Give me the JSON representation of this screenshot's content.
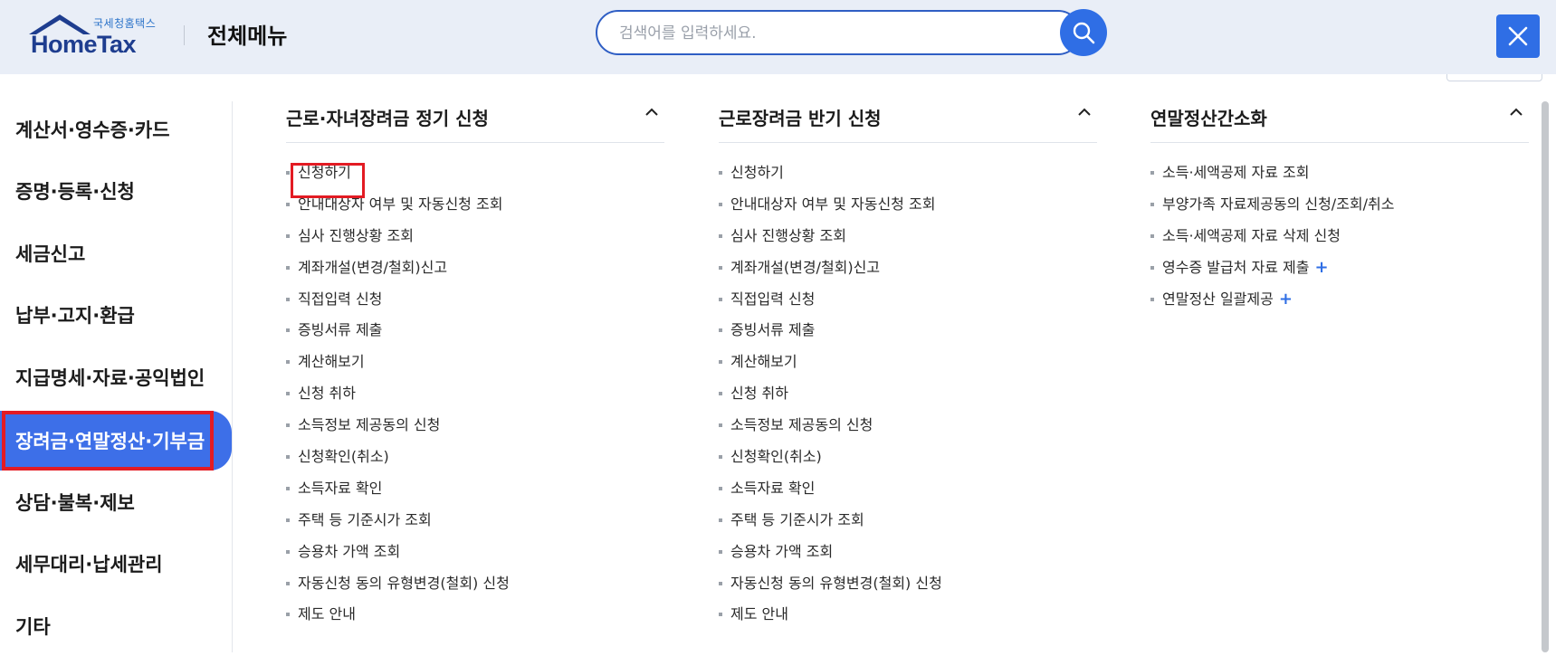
{
  "header": {
    "logo_sub": "국세청홈택스",
    "logo_main": "HomeTax",
    "title": "전체메뉴",
    "search_placeholder": "검색어를 입력하세요."
  },
  "icons": {
    "search": "search-icon",
    "close": "close-icon",
    "chevron": "chevron-up-icon",
    "plus": "plus-icon"
  },
  "colors": {
    "accent": "#2f6ee5",
    "active_bg": "#3d6fe8",
    "highlight": "#e31b23",
    "header_bg": "#e9eef7"
  },
  "sidebar": {
    "items": [
      {
        "label": "계산서·영수증·카드"
      },
      {
        "label": "증명·등록·신청"
      },
      {
        "label": "세금신고"
      },
      {
        "label": "납부·고지·환급"
      },
      {
        "label": "지급명세·자료·공익법인"
      },
      {
        "label": "장려금·연말정산·기부금",
        "active": true
      },
      {
        "label": "상담·불복·제보"
      },
      {
        "label": "세무대리·납세관리"
      },
      {
        "label": "기타"
      }
    ]
  },
  "columns": [
    {
      "title": "근로·자녀장려금 정기 신청",
      "items": [
        {
          "label": "신청하기"
        },
        {
          "label": "안내대상자 여부 및 자동신청 조회"
        },
        {
          "label": "심사 진행상황 조회"
        },
        {
          "label": "계좌개설(변경/철회)신고"
        },
        {
          "label": "직접입력 신청"
        },
        {
          "label": "증빙서류 제출"
        },
        {
          "label": "계산해보기"
        },
        {
          "label": "신청 취하"
        },
        {
          "label": "소득정보 제공동의 신청"
        },
        {
          "label": "신청확인(취소)"
        },
        {
          "label": "소득자료 확인"
        },
        {
          "label": "주택 등 기준시가 조회"
        },
        {
          "label": "승용차 가액 조회"
        },
        {
          "label": "자동신청 동의 유형변경(철회) 신청"
        },
        {
          "label": "제도 안내"
        }
      ]
    },
    {
      "title": "근로장려금 반기 신청",
      "items": [
        {
          "label": "신청하기"
        },
        {
          "label": "안내대상자 여부 및 자동신청 조회"
        },
        {
          "label": "심사 진행상황 조회"
        },
        {
          "label": "계좌개설(변경/철회)신고"
        },
        {
          "label": "직접입력 신청"
        },
        {
          "label": "증빙서류 제출"
        },
        {
          "label": "계산해보기"
        },
        {
          "label": "신청 취하"
        },
        {
          "label": "소득정보 제공동의 신청"
        },
        {
          "label": "신청확인(취소)"
        },
        {
          "label": "소득자료 확인"
        },
        {
          "label": "주택 등 기준시가 조회"
        },
        {
          "label": "승용차 가액 조회"
        },
        {
          "label": "자동신청 동의 유형변경(철회) 신청"
        },
        {
          "label": "제도 안내"
        }
      ]
    },
    {
      "title": "연말정산간소화",
      "items": [
        {
          "label": "소득·세액공제 자료 조회"
        },
        {
          "label": "부양가족 자료제공동의 신청/조회/취소"
        },
        {
          "label": "소득·세액공제 자료 삭제 신청"
        },
        {
          "label": "영수증 발급처 자료 제출",
          "plus": "+"
        },
        {
          "label": "연말정산 일괄제공",
          "plus": "+"
        }
      ]
    }
  ]
}
